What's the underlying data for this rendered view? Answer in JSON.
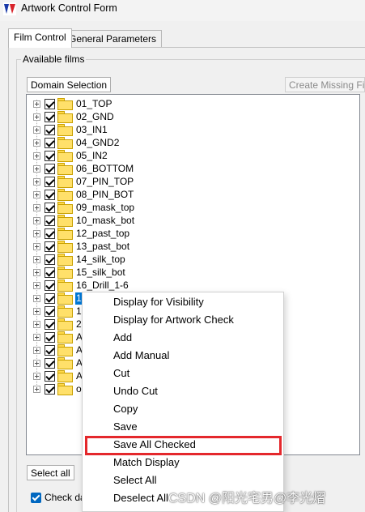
{
  "window": {
    "title": "Artwork Control Form",
    "icon": "app-logo-icon"
  },
  "tabs": [
    {
      "label": "Film Control",
      "active": true
    },
    {
      "label": "General Parameters",
      "active": false
    }
  ],
  "group": {
    "label": "Available films"
  },
  "buttons": {
    "domain_selection": "Domain Selection",
    "create_missing_films": "Create Missing Films",
    "select_all": "Select all"
  },
  "films": [
    {
      "label": "01_TOP",
      "checked": true
    },
    {
      "label": "02_GND",
      "checked": true
    },
    {
      "label": "03_IN1",
      "checked": true
    },
    {
      "label": "04_GND2",
      "checked": true
    },
    {
      "label": "05_IN2",
      "checked": true
    },
    {
      "label": "06_BOTTOM",
      "checked": true
    },
    {
      "label": "07_PIN_TOP",
      "checked": true
    },
    {
      "label": "08_PIN_BOT",
      "checked": true
    },
    {
      "label": "09_mask_top",
      "checked": true
    },
    {
      "label": "10_mask_bot",
      "checked": true
    },
    {
      "label": "12_past_top",
      "checked": true
    },
    {
      "label": "13_past_bot",
      "checked": true
    },
    {
      "label": "14_silk_top",
      "checked": true
    },
    {
      "label": "15_silk_bot",
      "checked": true
    },
    {
      "label": "16_Drill_1-6",
      "checked": true
    },
    {
      "label": "1",
      "checked": true,
      "selected": true
    },
    {
      "label": "1",
      "checked": true
    },
    {
      "label": "2",
      "checked": true
    },
    {
      "label": "A",
      "checked": true
    },
    {
      "label": "A",
      "checked": true
    },
    {
      "label": "A",
      "checked": true
    },
    {
      "label": "A",
      "checked": true
    },
    {
      "label": "o",
      "checked": true
    }
  ],
  "context_menu": [
    {
      "label": "Display for Visibility"
    },
    {
      "label": "Display for Artwork Check"
    },
    {
      "label": "Add"
    },
    {
      "label": "Add Manual"
    },
    {
      "label": "Cut"
    },
    {
      "label": "Undo Cut"
    },
    {
      "label": "Copy"
    },
    {
      "label": "Save"
    },
    {
      "label": "Save All Checked",
      "highlighted": true
    },
    {
      "label": "Match Display"
    },
    {
      "label": "Select All"
    },
    {
      "label": "Deselect All"
    }
  ],
  "check_database": {
    "label": "Check da",
    "checked": true
  },
  "watermark": "CSDN @阳光宅男@李光熠",
  "colors": {
    "highlight_box": "#e4282c",
    "selection": "#0078d7",
    "folder": "#ffe06a"
  }
}
